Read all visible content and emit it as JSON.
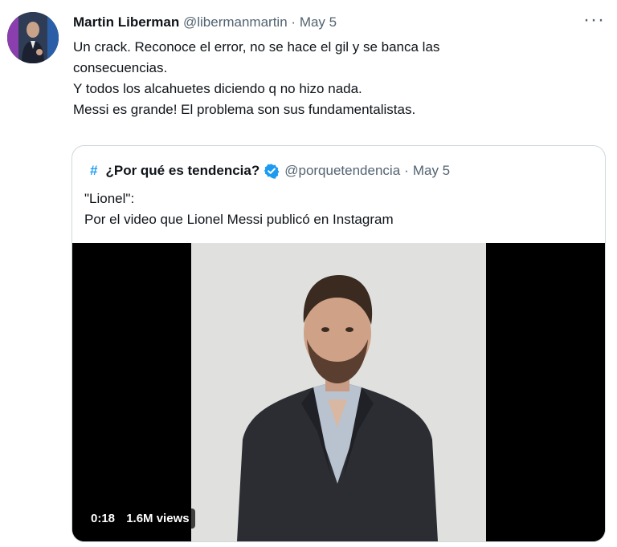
{
  "tweet": {
    "author_name": "Martin Liberman",
    "author_handle": "@libermanmartin",
    "separator": "·",
    "date": "May 5",
    "more_icon": "more-icon",
    "text_lines": [
      "Un crack. Reconoce el error, no se hace el gil y se banca las",
      "consecuencias.",
      "Y todos los alcahuetes diciendo q no hizo nada.",
      "Messi es grande! El problema son sus fundamentalistas."
    ]
  },
  "quote": {
    "icon": "#",
    "name": "¿Por qué es tendencia?",
    "handle": "@porquetendencia",
    "separator": "·",
    "date": "May 5",
    "text_lines": [
      "\"Lionel\":",
      "Por el video que Lionel Messi publicó en Instagram"
    ],
    "video": {
      "duration": "0:18",
      "views": "1.6M views"
    }
  },
  "colors": {
    "accent": "#1d9bf0",
    "text": "#0f1419",
    "muted": "#536471",
    "border": "#cfd9de"
  }
}
